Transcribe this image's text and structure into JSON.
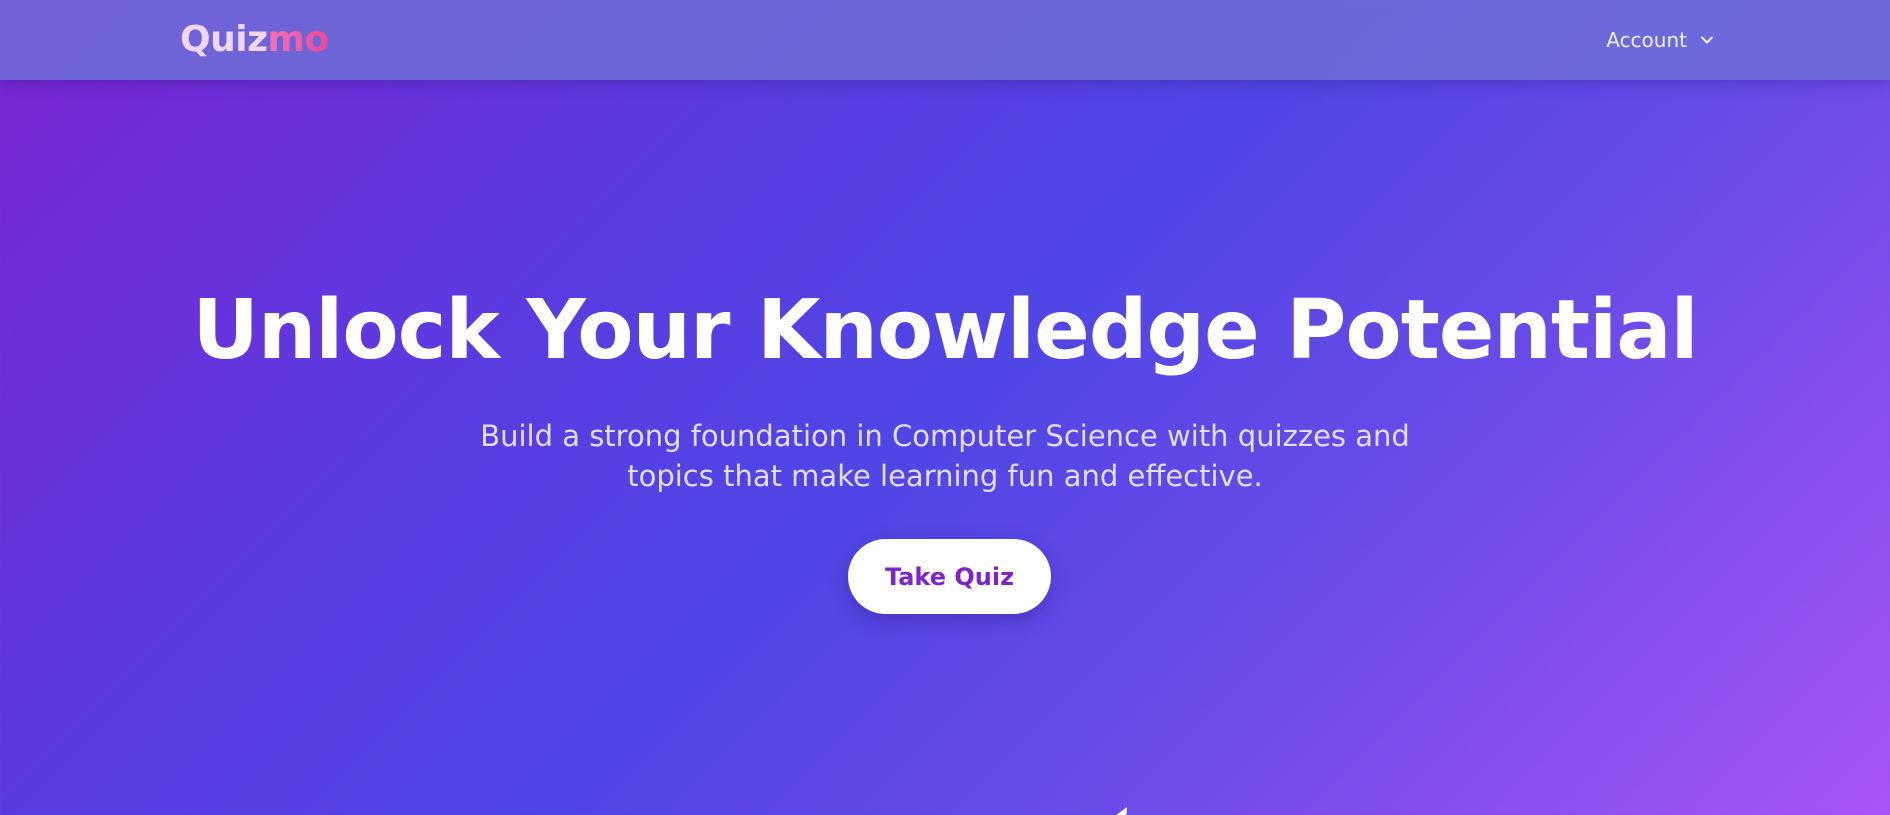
{
  "navbar": {
    "logo_part1": "Quiz",
    "logo_part2": "mo",
    "account_label": "Account"
  },
  "hero": {
    "title": "Unlock Your Knowledge Potential",
    "subtitle": "Build a strong foundation in Computer Science with quizzes and\ntopics that make learning fun and effective.",
    "cta_label": "Take Quiz"
  },
  "colors": {
    "brand_purple": "#7e22ce",
    "logo_pink": "#ec4899",
    "gradient_start": "#7b24d2",
    "gradient_mid": "#4f46e5",
    "gradient_end": "#a855f7"
  },
  "icons": {
    "account_dropdown": "chevron-down-icon"
  }
}
